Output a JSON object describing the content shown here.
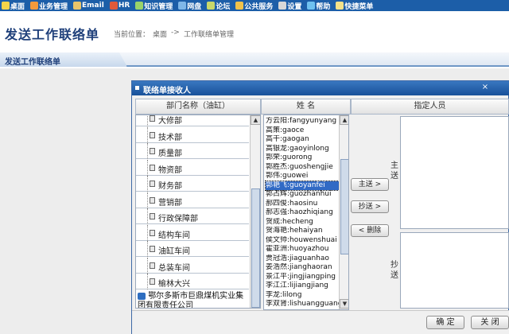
{
  "menu": {
    "items": [
      {
        "label": "桌面",
        "icon": "desktop-icon",
        "color": "#f5d44a"
      },
      {
        "label": "业务管理",
        "icon": "user-icon",
        "color": "#f39a3c"
      },
      {
        "label": "Email",
        "icon": "email-icon",
        "color": "#e9c46a"
      },
      {
        "label": "HR",
        "icon": "hr-icon",
        "color": "#e05a3a"
      },
      {
        "label": "知识管理",
        "icon": "knowledge-icon",
        "color": "#9ad36a"
      },
      {
        "label": "网盘",
        "icon": "disk-icon",
        "color": "#7fb7e8"
      },
      {
        "label": "论坛",
        "icon": "forum-icon",
        "color": "#c9d86a"
      },
      {
        "label": "公共服务",
        "icon": "service-icon",
        "color": "#f0c24a"
      },
      {
        "label": "设置",
        "icon": "gear-icon",
        "color": "#d8d8d8"
      },
      {
        "label": "帮助",
        "icon": "help-icon",
        "color": "#6fc2f0"
      },
      {
        "label": "快捷菜单",
        "icon": "shortcut-icon",
        "color": "#f4e28a"
      }
    ]
  },
  "header": {
    "title": "发送工作联络单",
    "breadcrumb_label": "当前位置：",
    "breadcrumb_home": "桌面",
    "breadcrumb_sep": "->",
    "breadcrumb_current": "工作联络单管理"
  },
  "tab": {
    "label": "发送工作联络单"
  },
  "dialog": {
    "title": "联络单接收人",
    "close": "×",
    "col_dept": "部门名称（油缸）",
    "col_name": "姓    名",
    "col_assigned": "指定人员",
    "departments": [
      "大修部",
      "技术部",
      "质量部",
      "物资部",
      "财务部",
      "营销部",
      "行政保障部",
      "结构车间",
      "油缸车间",
      "总装车间",
      "榆林大兴"
    ],
    "root_company": "鄂尔多斯市巨鼎煤机实业集团有限责任公司",
    "names": [
      "方云阳:fangyunyang",
      "高策:gaoce",
      "高干:gaogan",
      "高银龙:gaoyinlong",
      "郭荣:guorong",
      "郭胜杰:guoshengjie",
      "郭伟:guowei",
      "郭艳飞:guoyanfei",
      "郭占辉:guozhanhui",
      "郝四俊:haosinu",
      "郝志强:haozhiqiang",
      "贺成:hecheng",
      "贺海艳:hehaiyan",
      "侯文帅:houwenshuai",
      "霍亚洲:huoyazhou",
      "贾冠浩:jiaguanhao",
      "姜浩然:jianghaoran",
      "景江平:jingjiangping",
      "李江江:lijiangjiang",
      "李龙:lilong",
      "李双肾:lishuangguang"
    ],
    "selected_name_index": 7,
    "btn_main": "主送 >",
    "btn_cc": "抄送 >",
    "btn_delete": "< 删除",
    "side_main": "主送",
    "side_cc": "抄送",
    "btn_ok": "确 定",
    "btn_close": "关 闭"
  }
}
